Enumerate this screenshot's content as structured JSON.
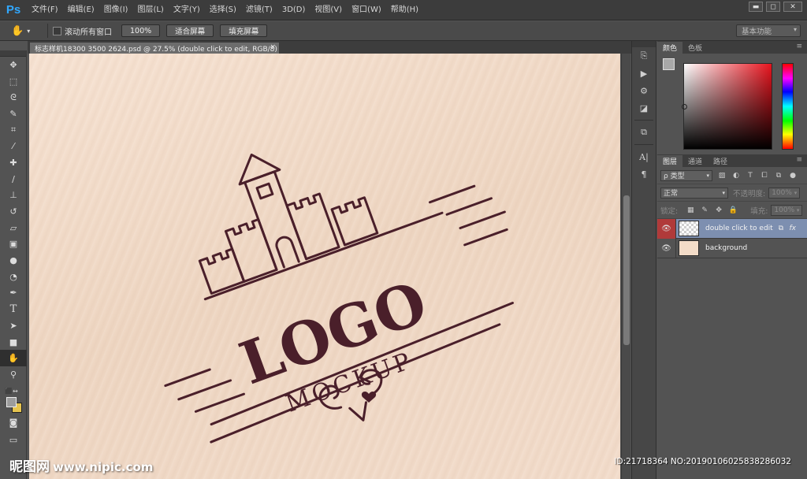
{
  "app": {
    "logo": "Ps"
  },
  "menu": [
    "文件(F)",
    "编辑(E)",
    "图像(I)",
    "图层(L)",
    "文字(Y)",
    "选择(S)",
    "滤镜(T)",
    "3D(D)",
    "视图(V)",
    "窗口(W)",
    "帮助(H)"
  ],
  "window_controls": {
    "minimize": "▬",
    "restore": "◻",
    "close": "✕"
  },
  "options": {
    "scroll_all_label": "滚动所有窗口",
    "btn_100": "100%",
    "btn_fit": "适合屏幕",
    "btn_fill": "填充屏幕",
    "workspace": "基本功能"
  },
  "document": {
    "tab_title": "标志样机18300 3500 2624.psd @ 27.5% (double click to edit, RGB/8)",
    "close": "×",
    "logo_word": "LOGO",
    "mockup_word": "MOCKUP"
  },
  "tools": [
    "move",
    "marquee",
    "lasso",
    "quick-select",
    "crop",
    "eyedropper",
    "healing",
    "brush",
    "stamp",
    "history-brush",
    "eraser",
    "gradient",
    "blur",
    "dodge",
    "pen",
    "type",
    "path-select",
    "shape",
    "hand",
    "zoom"
  ],
  "color_panel": {
    "tabs": [
      "颜色",
      "色板"
    ],
    "fg": "#a8a8a8",
    "bg": "#f1cc4a"
  },
  "layers_panel": {
    "tabs": [
      "图层",
      "通道",
      "路径"
    ],
    "filter_kind": "ρ 类型",
    "blend_mode": "正常",
    "opacity_label": "不透明度:",
    "opacity_value": "100%",
    "lock_label": "锁定:",
    "fill_label": "填充:",
    "fill_value": "100%",
    "layers": [
      {
        "name": "double click to edit",
        "selected": true,
        "fx": "fx"
      },
      {
        "name": "background",
        "selected": false
      }
    ]
  },
  "watermark": {
    "site_name": "昵图网",
    "url": "www.nipic.com",
    "id_text": "ID:21718364 NO:20190106025838286032"
  }
}
